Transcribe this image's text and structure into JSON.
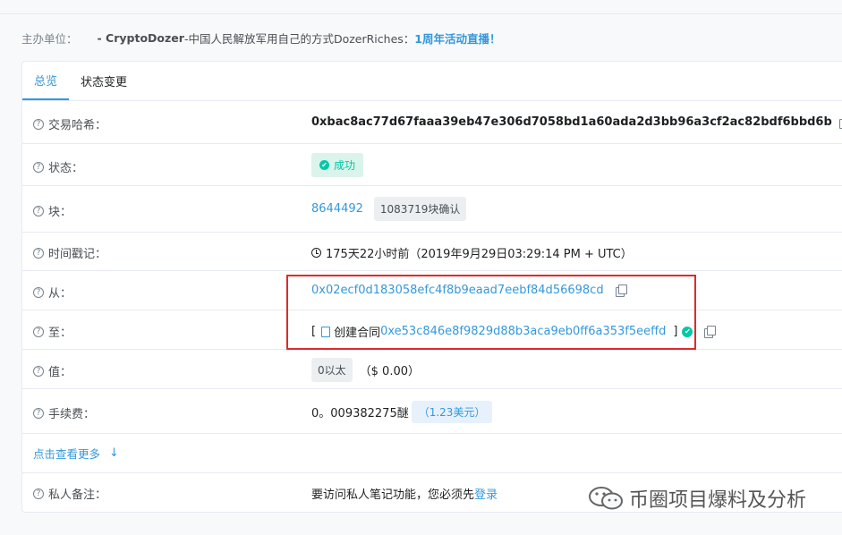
{
  "sponsor": {
    "label": "主办单位：",
    "brand": "- CryptoDozer",
    "description": " -中国人民解放军用自己的方式DozerRiches：",
    "link": "1周年活动直播！"
  },
  "tabs": [
    {
      "label": "总览"
    },
    {
      "label": "状态变更"
    }
  ],
  "rows": {
    "tx_hash": {
      "label": "交易哈希：",
      "value": "0xbac8ac77d67faaa39eb47e306d7058bd1a60ada2d3bb96a3cf2ac82bdf6bbd6b"
    },
    "status": {
      "label": "状态：",
      "value": "成功"
    },
    "block": {
      "label": "块：",
      "number": "8644492",
      "confirmations": "1083719块确认"
    },
    "timestamp": {
      "label": "时间戳记：",
      "value": "175天22小时前（2019年9月29日03:29:14 PM + UTC）"
    },
    "from": {
      "label": "从：",
      "value": "0x02ecf0d183058efc4f8b9eaad7eebf84d56698cd"
    },
    "to": {
      "label": "至：",
      "open": "[",
      "prefix": "创建合同",
      "contract": "0xe53c846e8f9829d88b3aca9eb0ff6a353f5eeffd",
      "close": "]"
    },
    "value": {
      "label": "值：",
      "eth": "0以太",
      "usd": "（$ 0.00）"
    },
    "fee": {
      "label": "手续费：",
      "eth": "0。009382275醚",
      "usd": "（1.23美元）"
    },
    "note": {
      "label": "私人备注：",
      "text": "要访问私人笔记功能，您必须先",
      "login": "登录"
    }
  },
  "more": {
    "label": "点击查看更多"
  },
  "watermark": {
    "text": "币圈项目爆料及分析"
  },
  "colors": {
    "accent": "#3498db",
    "success": "#00c9a7",
    "highlight_box": "#e0292b"
  }
}
